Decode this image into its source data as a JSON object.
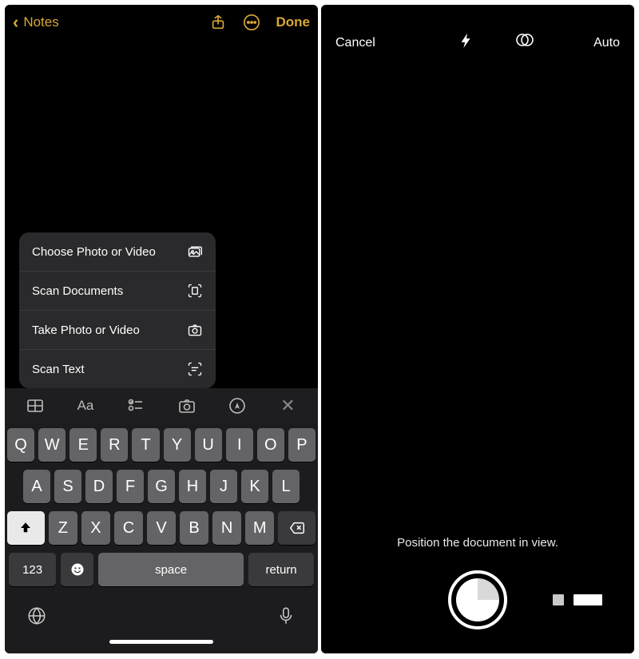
{
  "notes": {
    "back_label": "Notes",
    "done_label": "Done",
    "popup": {
      "choose": "Choose Photo or Video",
      "scan_docs": "Scan Documents",
      "take": "Take Photo or Video",
      "scan_text": "Scan Text"
    },
    "toolbar": {
      "table": "table-icon",
      "format": "Aa",
      "checklist": "checklist-icon",
      "camera": "camera-icon",
      "markup": "markup-icon",
      "close": "close-icon"
    },
    "keyboard": {
      "row1": [
        "Q",
        "W",
        "E",
        "R",
        "T",
        "Y",
        "U",
        "I",
        "O",
        "P"
      ],
      "row2": [
        "A",
        "S",
        "D",
        "F",
        "G",
        "H",
        "J",
        "K",
        "L"
      ],
      "row3": [
        "Z",
        "X",
        "C",
        "V",
        "B",
        "N",
        "M"
      ],
      "numeric": "123",
      "space": "space",
      "return": "return"
    }
  },
  "scanner": {
    "cancel": "Cancel",
    "flash_mode": "auto",
    "capture_mode": "Auto",
    "caption": "Position the document in view."
  }
}
